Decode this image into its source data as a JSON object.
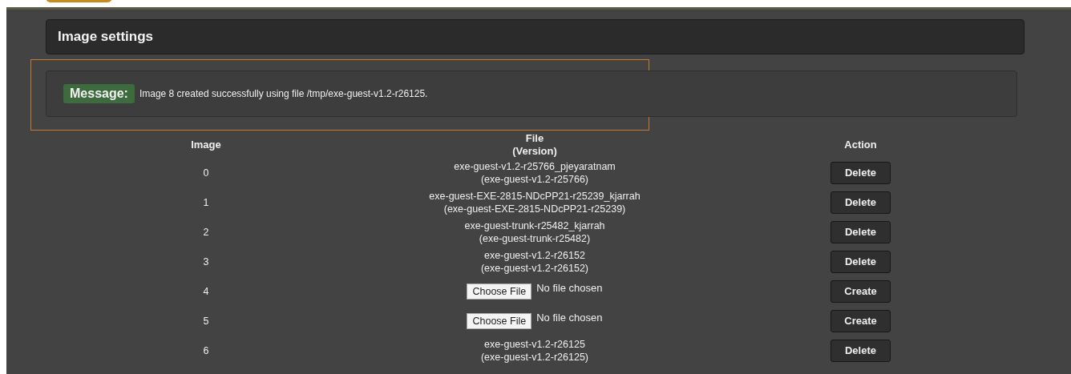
{
  "panel": {
    "title": "Image settings"
  },
  "message": {
    "label": "Message:",
    "text": "Image 8 created successfully using file /tmp/exe-guest-v1.2-r26125."
  },
  "table": {
    "columns": [
      "Image",
      "File\n(Version)",
      "Action"
    ],
    "rows": [
      {
        "image": "0",
        "kind": "file",
        "name": "exe-guest-v1.2-r25766_pjeyaratnam",
        "version": "(exe-guest-v1.2-r25766)",
        "action": "Delete"
      },
      {
        "image": "1",
        "kind": "file",
        "name": "exe-guest-EXE-2815-NDcPP21-r25239_kjarrah",
        "version": "(exe-guest-EXE-2815-NDcPP21-r25239)",
        "action": "Delete"
      },
      {
        "image": "2",
        "kind": "file",
        "name": "exe-guest-trunk-r25482_kjarrah",
        "version": "(exe-guest-trunk-r25482)",
        "action": "Delete"
      },
      {
        "image": "3",
        "kind": "file",
        "name": "exe-guest-v1.2-r26152",
        "version": "(exe-guest-v1.2-r26152)",
        "action": "Delete"
      },
      {
        "image": "4",
        "kind": "upload",
        "button": "Choose File",
        "status": "No file chosen",
        "action": "Create"
      },
      {
        "image": "5",
        "kind": "upload",
        "button": "Choose File",
        "status": "No file chosen",
        "action": "Create"
      },
      {
        "image": "6",
        "kind": "file",
        "name": "exe-guest-v1.2-r26125",
        "version": "(exe-guest-v1.2-r26125)",
        "action": "Delete"
      }
    ]
  }
}
